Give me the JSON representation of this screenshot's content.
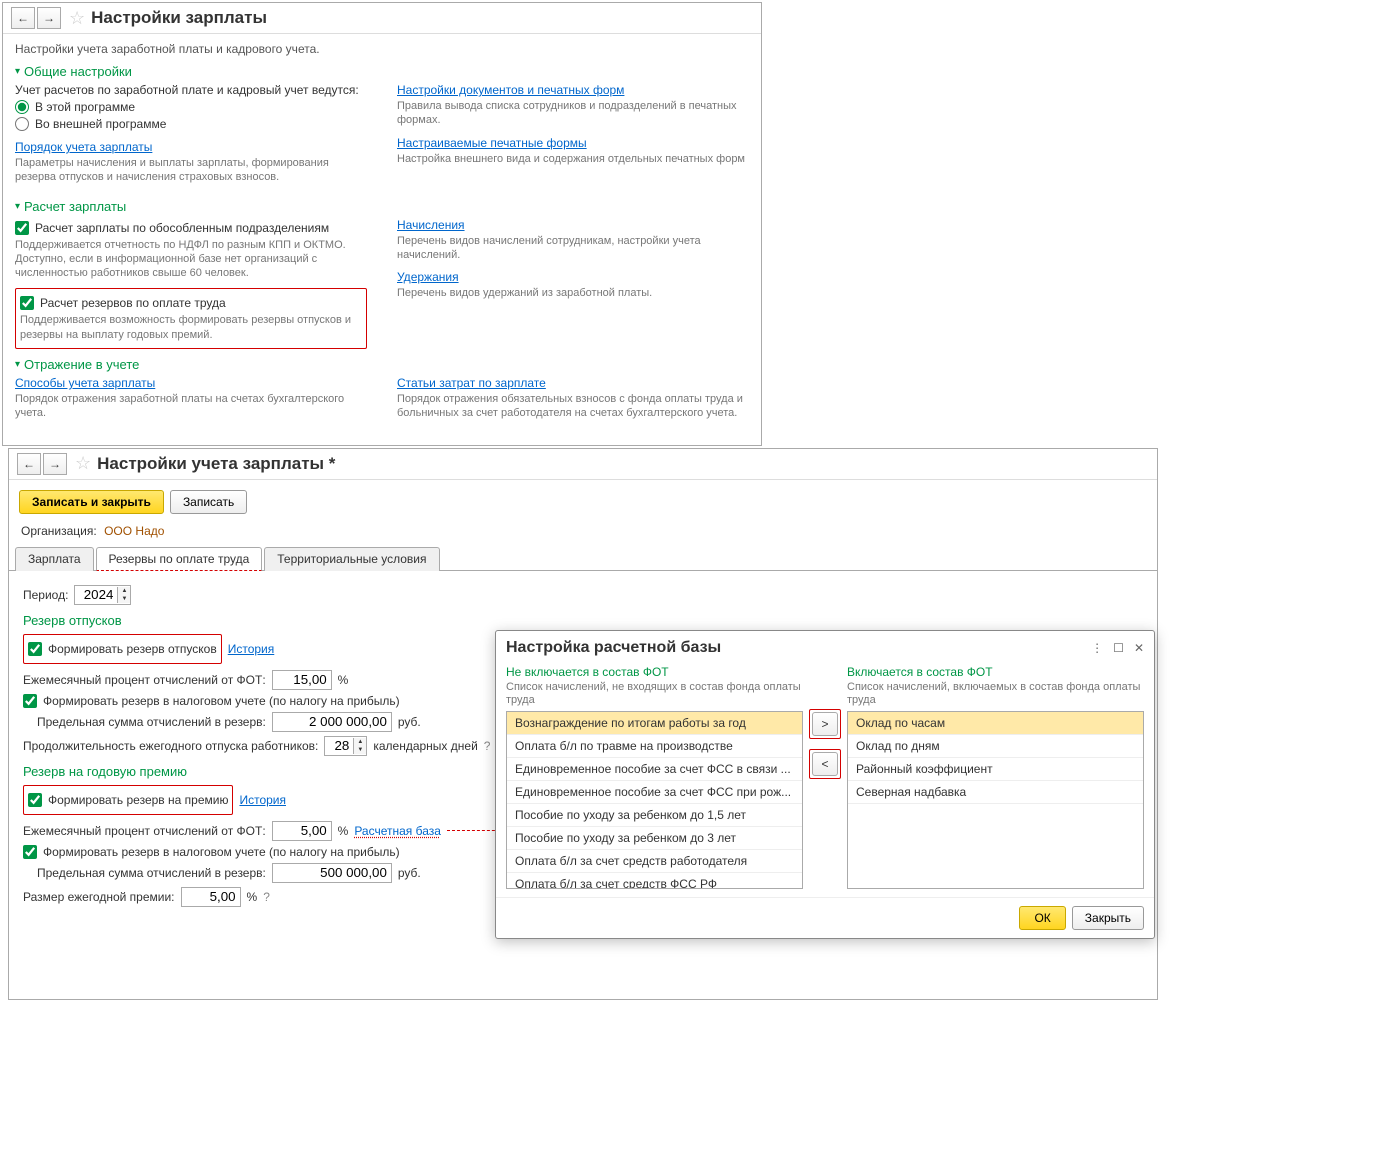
{
  "panel1": {
    "title": "Настройки зарплаты",
    "subtitle": "Настройки учета заработной платы и кадрового учета.",
    "sec_general": "Общие настройки",
    "general_label": "Учет расчетов по заработной плате и кадровый учет ведутся:",
    "radio_in_prog": "В этой программе",
    "radio_external": "Во внешней программе",
    "link_order": "Порядок учета зарплаты",
    "desc_order": "Параметры начисления и выплаты зарплаты, формирования резерва отпусков и начисления страховых взносов.",
    "link_docs": "Настройки документов и печатных форм",
    "desc_docs": "Правила вывода списка сотрудников и подразделений в печатных формах.",
    "link_forms": "Настраиваемые печатные формы",
    "desc_forms": "Настройка внешнего вида и содержания отдельных печатных форм",
    "sec_calc": "Расчет зарплаты",
    "cb_separate": "Расчет зарплаты по обособленным подразделениям",
    "desc_separate": "Поддерживается отчетность по НДФЛ по разным КПП и ОКТМО. Доступно, если в информационной базе нет организаций с численностью работников свыше 60 человек.",
    "cb_reserve": "Расчет резервов по оплате труда",
    "desc_reserve": "Поддерживается возможность формировать резервы отпусков и резервы на выплату годовых премий.",
    "link_accruals": "Начисления",
    "desc_accruals": "Перечень видов начислений сотрудникам, настройки учета начислений.",
    "link_deduct": "Удержания",
    "desc_deduct": "Перечень видов удержаний из заработной платы.",
    "sec_reflect": "Отражение в учете",
    "link_ways": "Способы учета зарплаты",
    "desc_ways": "Порядок отражения заработной платы на счетах бухгалтерского учета.",
    "link_costs": "Статьи затрат по зарплате",
    "desc_costs": "Порядок отражения обязательных взносов с фонда оплаты труда и больничных за счет работодателя на счетах бухгалтерского учета."
  },
  "panel2": {
    "title": "Настройки учета зарплаты *",
    "btn_save_close": "Записать и закрыть",
    "btn_save": "Записать",
    "org_label": "Организация:",
    "org_value": "ООО Надо",
    "tab1": "Зарплата",
    "tab2": "Резервы по оплате труда",
    "tab3": "Территориальные условия",
    "period_label": "Период:",
    "period_val": "2024",
    "head_vac": "Резерв отпусков",
    "cb_form_vac": "Формировать резерв отпусков",
    "link_history": "История",
    "lbl_monthly": "Ежемесячный процент отчислений от ФОТ:",
    "val_vac_pct": "15,00",
    "cb_tax_vac": "Формировать резерв в налоговом учете (по налогу на прибыль)",
    "lbl_limit": "Предельная сумма отчислений в резерв:",
    "val_vac_limit": "2 000 000,00",
    "rub": "руб.",
    "lbl_duration": "Продолжительность ежегодного отпуска работников:",
    "val_days": "28",
    "cal_days": "календарных дней",
    "head_bonus": "Резерв на годовую премию",
    "cb_form_bonus": "Формировать резерв на премию",
    "val_bonus_pct": "5,00",
    "link_base": "Расчетная база",
    "val_bonus_limit": "500 000,00",
    "lbl_bonus_size": "Размер ежегодной премии:",
    "val_bonus_size": "5,00"
  },
  "modal": {
    "title": "Настройка расчетной базы",
    "left_head": "Не включается в состав ФОТ",
    "left_desc": "Список начислений, не входящих в состав фонда оплаты труда",
    "left_items": [
      "Вознаграждение по итогам работы за год",
      "Оплата б/л по травме на производстве",
      "Единовременное пособие за счет ФСС в связи ...",
      "Единовременное пособие за счет ФСС при рож...",
      "Пособие по уходу за ребенком до 1,5 лет",
      "Пособие по уходу за ребенком до 3 лет",
      "Оплата б/л за счет средств работодателя",
      "Оплата б/л за счет средств ФСС РФ"
    ],
    "right_head": "Включается в состав ФОТ",
    "right_desc": "Список начислений, включаемых в состав фонда оплаты труда",
    "right_items": [
      "Оклад по часам",
      "Оклад по дням",
      "Районный коэффициент",
      "Северная надбавка"
    ],
    "btn_ok": "ОК",
    "btn_close": "Закрыть"
  }
}
